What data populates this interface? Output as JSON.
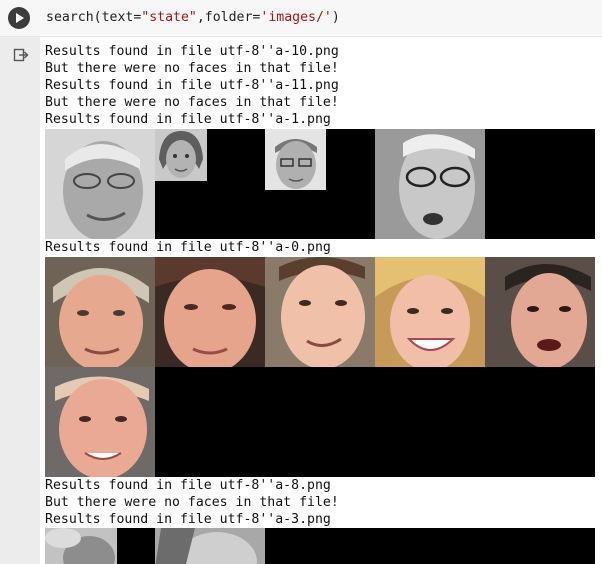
{
  "cell": {
    "code_prefix": "search(text=",
    "arg_text": "\"state\"",
    "code_mid": ",folder=",
    "arg_folder": "'images/'",
    "code_suffix": ")"
  },
  "output": {
    "lines": [
      "Results found in file utf-8''a-10.png",
      "But there were no faces in that file!",
      "Results found in file utf-8''a-11.png",
      "But there were no faces in that file!",
      "Results found in file utf-8''a-1.png",
      "Results found in file utf-8''a-0.png",
      "Results found in file utf-8''a-8.png",
      "But there were no faces in that file!",
      "Results found in file utf-8''a-3.png"
    ]
  },
  "colors": {
    "run_button": "#3c3c3c",
    "string_literal": "#a31515",
    "gutter": "#ececec"
  },
  "icons": [
    "run-icon",
    "output-icon"
  ]
}
